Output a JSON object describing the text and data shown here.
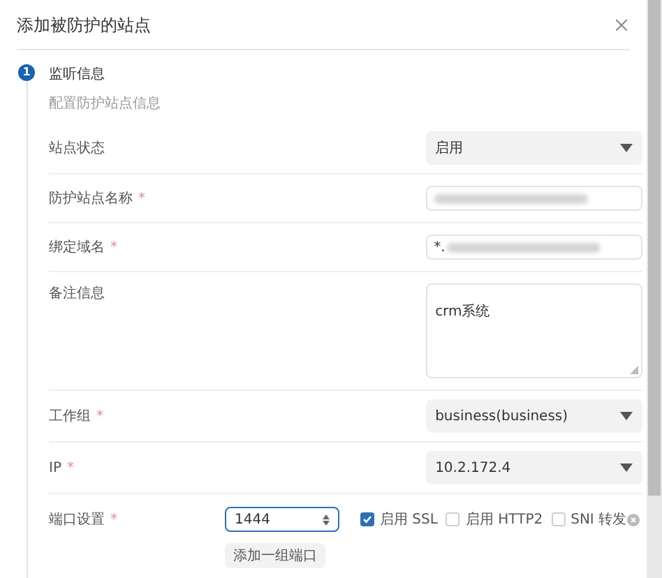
{
  "dialog": {
    "title": "添加被防护的站点"
  },
  "step": {
    "number": "1",
    "title": "监听信息",
    "subtitle": "配置防护站点信息",
    "active": true
  },
  "fields": [
    {
      "kind": "select",
      "label": "站点状态",
      "value": "启用"
    },
    {
      "kind": "input",
      "label": "防护站点名称",
      "required_mark": "*",
      "redacted": true
    },
    {
      "kind": "input",
      "label": "绑定域名",
      "required_mark": "*",
      "value": "*.",
      "redacted": true
    },
    {
      "kind": "textarea",
      "label": "备注信息",
      "value": "crm系统"
    },
    {
      "kind": "select",
      "label": "工作组",
      "required_mark": "*",
      "value": "business(business)"
    },
    {
      "kind": "select",
      "label": "IP",
      "required_mark": "*",
      "value": "10.2.172.4"
    },
    {
      "kind": "ports",
      "label": "端口设置",
      "required_mark": "*",
      "value": "1444",
      "options": [
        {
          "label": "启用 SSL",
          "checked": true
        },
        {
          "label": "启用 HTTP2",
          "checked": false
        },
        {
          "label": "SNI 转发",
          "checked": false
        }
      ],
      "add_button": "添加一组端口"
    }
  ]
}
